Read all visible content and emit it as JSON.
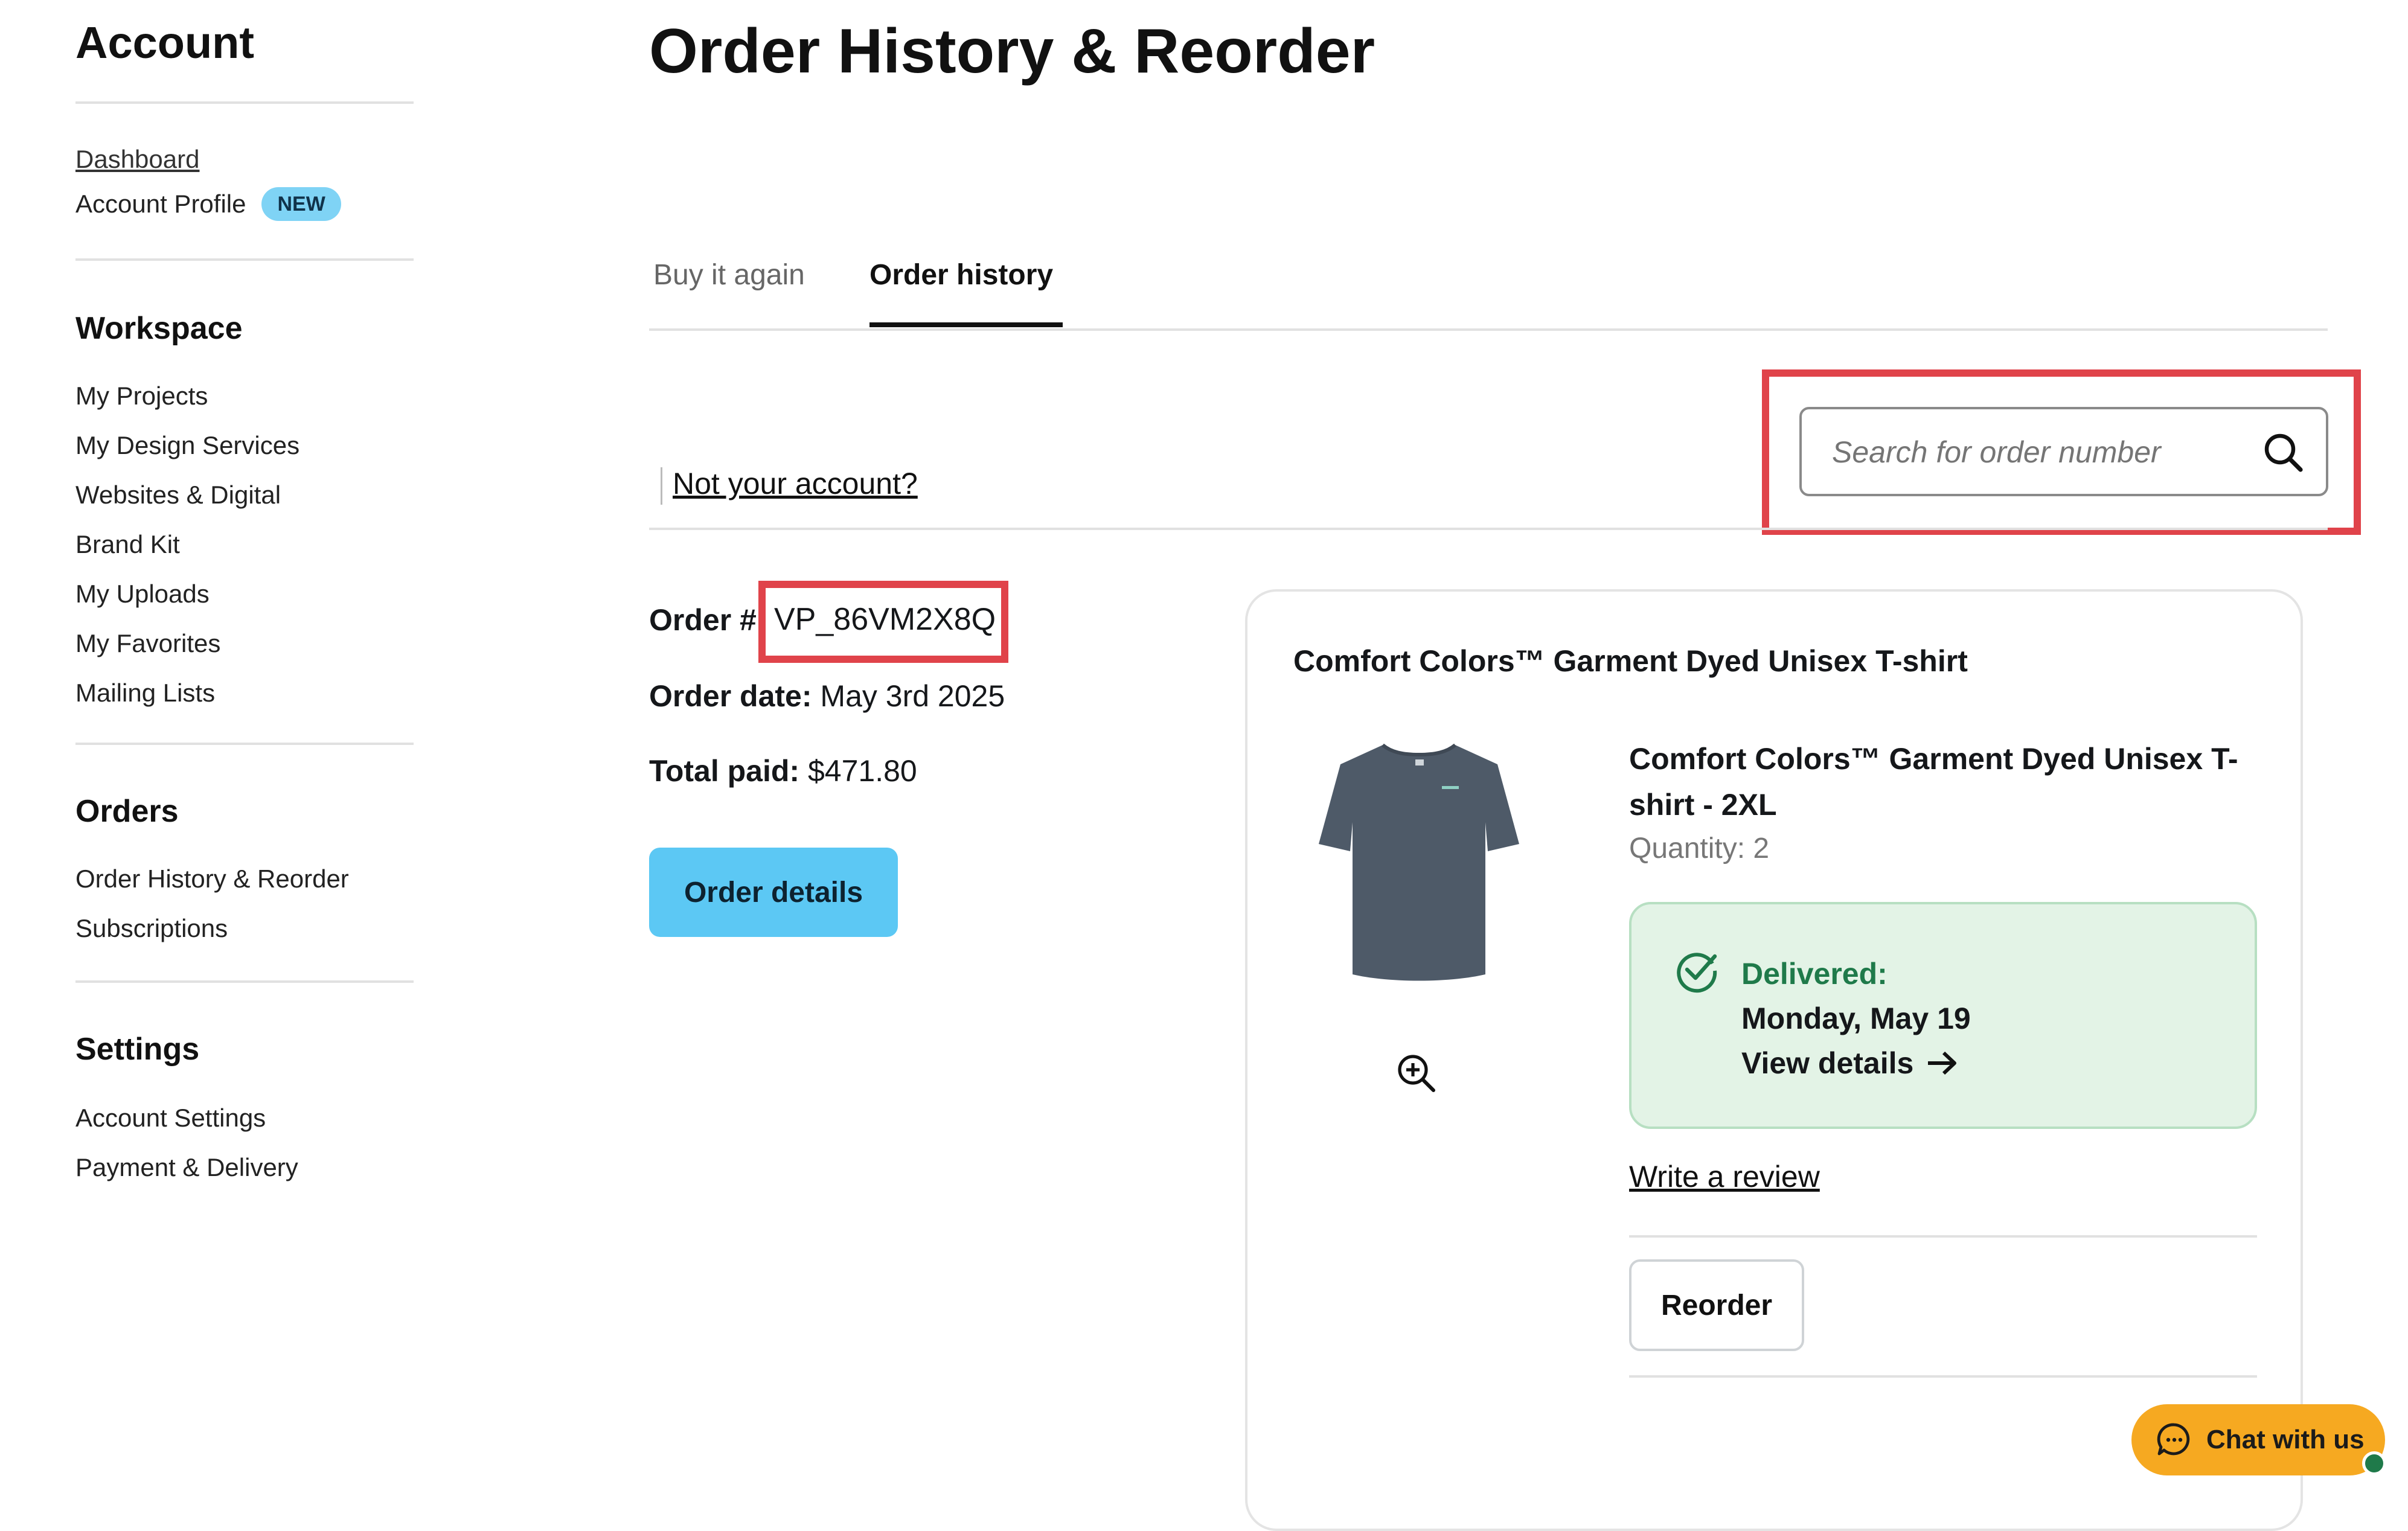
{
  "sidebar": {
    "title": "Account",
    "top_links": [
      {
        "label": "Dashboard"
      },
      {
        "label": "Account Profile",
        "badge": "NEW"
      }
    ],
    "sections": [
      {
        "heading": "Workspace",
        "items": [
          "My Projects",
          "My Design Services",
          "Websites & Digital",
          "Brand Kit",
          "My Uploads",
          "My Favorites",
          "Mailing Lists"
        ]
      },
      {
        "heading": "Orders",
        "items": [
          "Order History & Reorder",
          "Subscriptions"
        ]
      },
      {
        "heading": "Settings",
        "items": [
          "Account Settings",
          "Payment & Delivery"
        ]
      }
    ]
  },
  "main": {
    "title": "Order History & Reorder",
    "tabs": [
      {
        "label": "Buy it again",
        "active": false
      },
      {
        "label": "Order history",
        "active": true
      }
    ],
    "not_account_link": "Not your account?",
    "search": {
      "placeholder": "Search for order number",
      "icon": "search-icon"
    }
  },
  "order": {
    "number_label": "Order #",
    "number": "VP_86VM2X8Q",
    "date_label": "Order date:",
    "date": "May 3rd 2025",
    "total_label": "Total paid:",
    "total": "$471.80",
    "details_button": "Order details"
  },
  "item": {
    "card_title": "Comfort Colors™ Garment Dyed Unisex T-shirt",
    "name_line1": "Comfort Colors™ Garment Dyed Unisex T-",
    "name_line2": "shirt - 2XL",
    "quantity": "Quantity: 2",
    "shirt_color": "#4e5a68",
    "status_label": "Delivered:",
    "status_date": "Monday, May 19",
    "view_details": "View details",
    "write_review": "Write a review",
    "reorder_button": "Reorder"
  },
  "chat": {
    "label": "Chat with us",
    "accent": "#f6a921"
  },
  "colors": {
    "highlight": "#e0434a",
    "primary": "#5cc8f4",
    "delivered_bg": "#e3f3e6",
    "delivered_text": "#1f7a4a"
  }
}
